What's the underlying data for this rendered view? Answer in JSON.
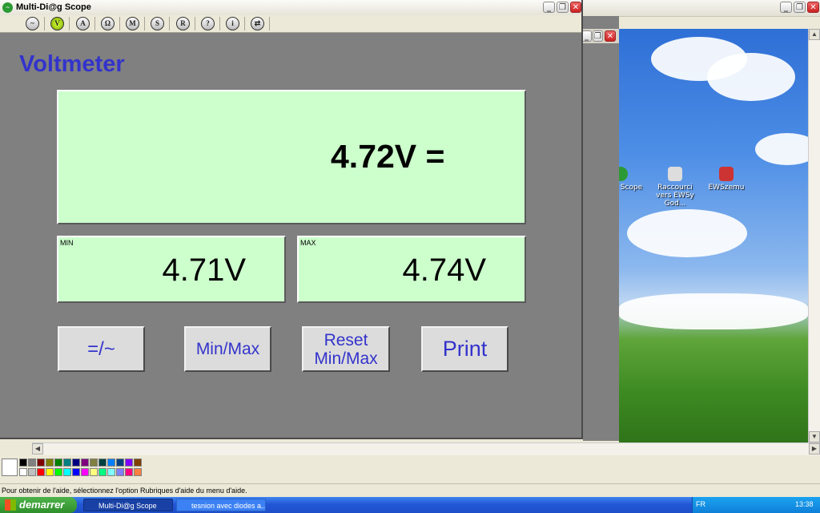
{
  "app": {
    "title": "Multi-Di@g Scope",
    "toolbar": [
      {
        "name": "oscilloscope-icon",
        "glyph": "~"
      },
      {
        "name": "voltmeter-icon",
        "glyph": "V",
        "active": true
      },
      {
        "name": "ammeter-icon",
        "glyph": "A"
      },
      {
        "name": "ohmmeter-icon",
        "glyph": "Ω"
      },
      {
        "name": "mode-m-icon",
        "glyph": "M"
      },
      {
        "name": "mode-s-icon",
        "glyph": "S"
      },
      {
        "name": "mode-r-icon",
        "glyph": "R"
      },
      {
        "name": "help-icon",
        "glyph": "?"
      },
      {
        "name": "info-icon",
        "glyph": "i"
      },
      {
        "name": "exit-icon",
        "glyph": "⇄"
      }
    ],
    "mode_title": "Voltmeter",
    "reading": "4.72V =",
    "min": {
      "label": "MIN",
      "value": "4.71V"
    },
    "max": {
      "label": "MAX",
      "value": "4.74V"
    },
    "buttons": {
      "acdc": "=/~",
      "minmax": "Min/Max",
      "reset_line1": "Reset",
      "reset_line2": "Min/Max",
      "print": "Print"
    },
    "colors": {
      "title": "#3333cc",
      "panel": "#ccffcc",
      "window_bg": "#808080"
    }
  },
  "desktop": {
    "icons": [
      "Di@g Scope",
      "Raccourci vers EWSy God...",
      "EWSzemu"
    ]
  },
  "paint": {
    "status": "Pour obtenir de l'aide, sélectionnez l'option Rubriques d'aide du menu d'aide."
  },
  "taskbar": {
    "start": "demarrer",
    "tasks": [
      "Multi-Di@g Scope",
      "tesnion avec diodes a..."
    ],
    "lang": "FR",
    "clock": "13:38"
  }
}
